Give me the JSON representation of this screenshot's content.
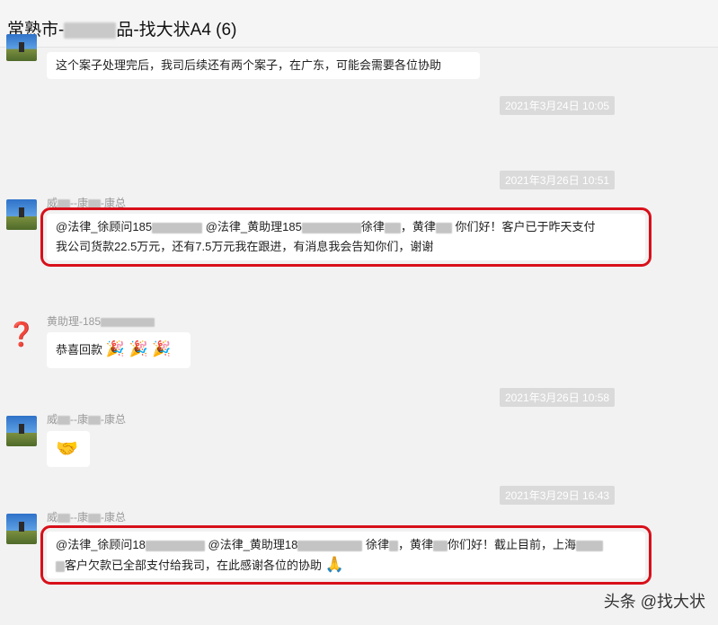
{
  "window": {
    "title_prefix": "常熟市-",
    "title_suffix": "品-找大状A4 (6)"
  },
  "messages": {
    "m0_text": "这个案子处理完后，我司后续还有两个案子，在广东，可能会需要各位协助",
    "ts1": "2021年3月24日 10:05",
    "ts2": "2021年3月26日 10:51",
    "m1_sender_a": "威",
    "m1_sender_b": "--康",
    "m1_sender_c": "-康总",
    "m1_line1_a": "@法律_徐顾问185",
    "m1_line1_b": " @法律_黄助理185",
    "m1_line1_c": "徐律",
    "m1_line1_d": "，黄律",
    "m1_line1_e": "  你们好！客户已于昨天支付",
    "m1_line2": "我公司货款22.5万元，还有7.5万元我在跟进，有消息我会告知你们，谢谢",
    "m2_sender": "黄助理-185",
    "m2_text": "恭喜回款",
    "m2_emoji": "🎉 🎉 🎉",
    "ts3": "2021年3月26日 10:58",
    "m3_sender_a": "威",
    "m3_sender_b": "--康",
    "m3_sender_c": "-康总",
    "m3_emoji": "🤝",
    "ts4": "2021年3月29日 16:43",
    "m4_sender_a": "威",
    "m4_sender_b": "--康",
    "m4_sender_c": "-康总",
    "m4_line1_a": "@法律_徐顾问18",
    "m4_line1_b": " @法律_黄助理18",
    "m4_line1_c": " 徐律",
    "m4_line1_d": "，黄律",
    "m4_line1_e": "你们好！截止目前，上海",
    "m4_line2": "客户欠款已全部支付给我司，在此感谢各位的协助",
    "m4_emoji": "🙏"
  },
  "watermark": "头条 @找大状",
  "icons": {
    "avatar_photo": "landscape-photo-avatar",
    "avatar_emoji": "🙂"
  },
  "colors": {
    "highlight": "#d8101a",
    "timestamp_bg": "#dadada",
    "chat_bg": "#f2f2f2"
  }
}
